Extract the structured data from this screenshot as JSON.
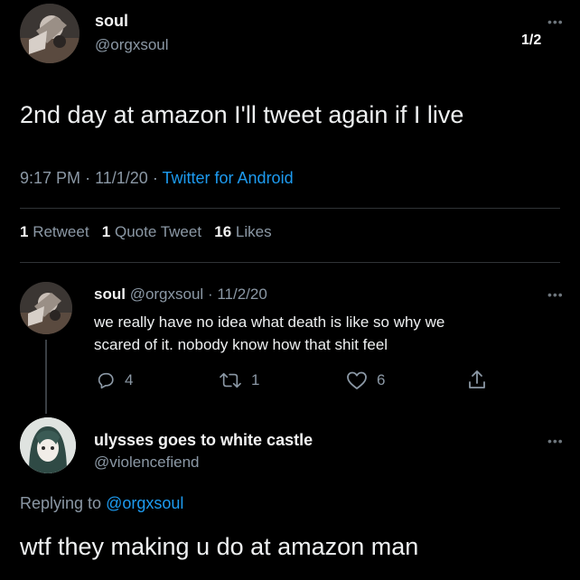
{
  "main_tweet": {
    "display_name": "soul",
    "handle": "@orgxsoul",
    "page_indicator": "1/2",
    "text": "2nd day at amazon I'll tweet again if I live",
    "time": "9:17 PM",
    "date": "11/1/20",
    "sep": "·",
    "source": "Twitter for Android",
    "stats": {
      "retweets_count": "1",
      "retweets_label": "Retweet",
      "quotes_count": "1",
      "quotes_label": "Quote Tweet",
      "likes_count": "16",
      "likes_label": "Likes"
    }
  },
  "reply_tweet": {
    "display_name": "soul",
    "handle": "@orgxsoul",
    "date": "11/2/20",
    "sep": "·",
    "line1": "we really have no idea what death is like so why we",
    "line2": "scared of it. nobody know how that shit feel",
    "actions": {
      "reply_count": "4",
      "retweet_count": "1",
      "like_count": "6"
    }
  },
  "final_tweet": {
    "display_name": "ulysses goes to white castle",
    "handle": "@violencefiend",
    "replying_prefix": "Replying to",
    "replying_handle": "@orgxsoul",
    "text": "wtf they making u do at amazon man"
  },
  "icons": {
    "menu": "more-dots-icon",
    "reply": "reply-bubble-icon",
    "retweet": "retweet-arrows-icon",
    "like": "heart-icon",
    "share": "share-upload-icon"
  }
}
